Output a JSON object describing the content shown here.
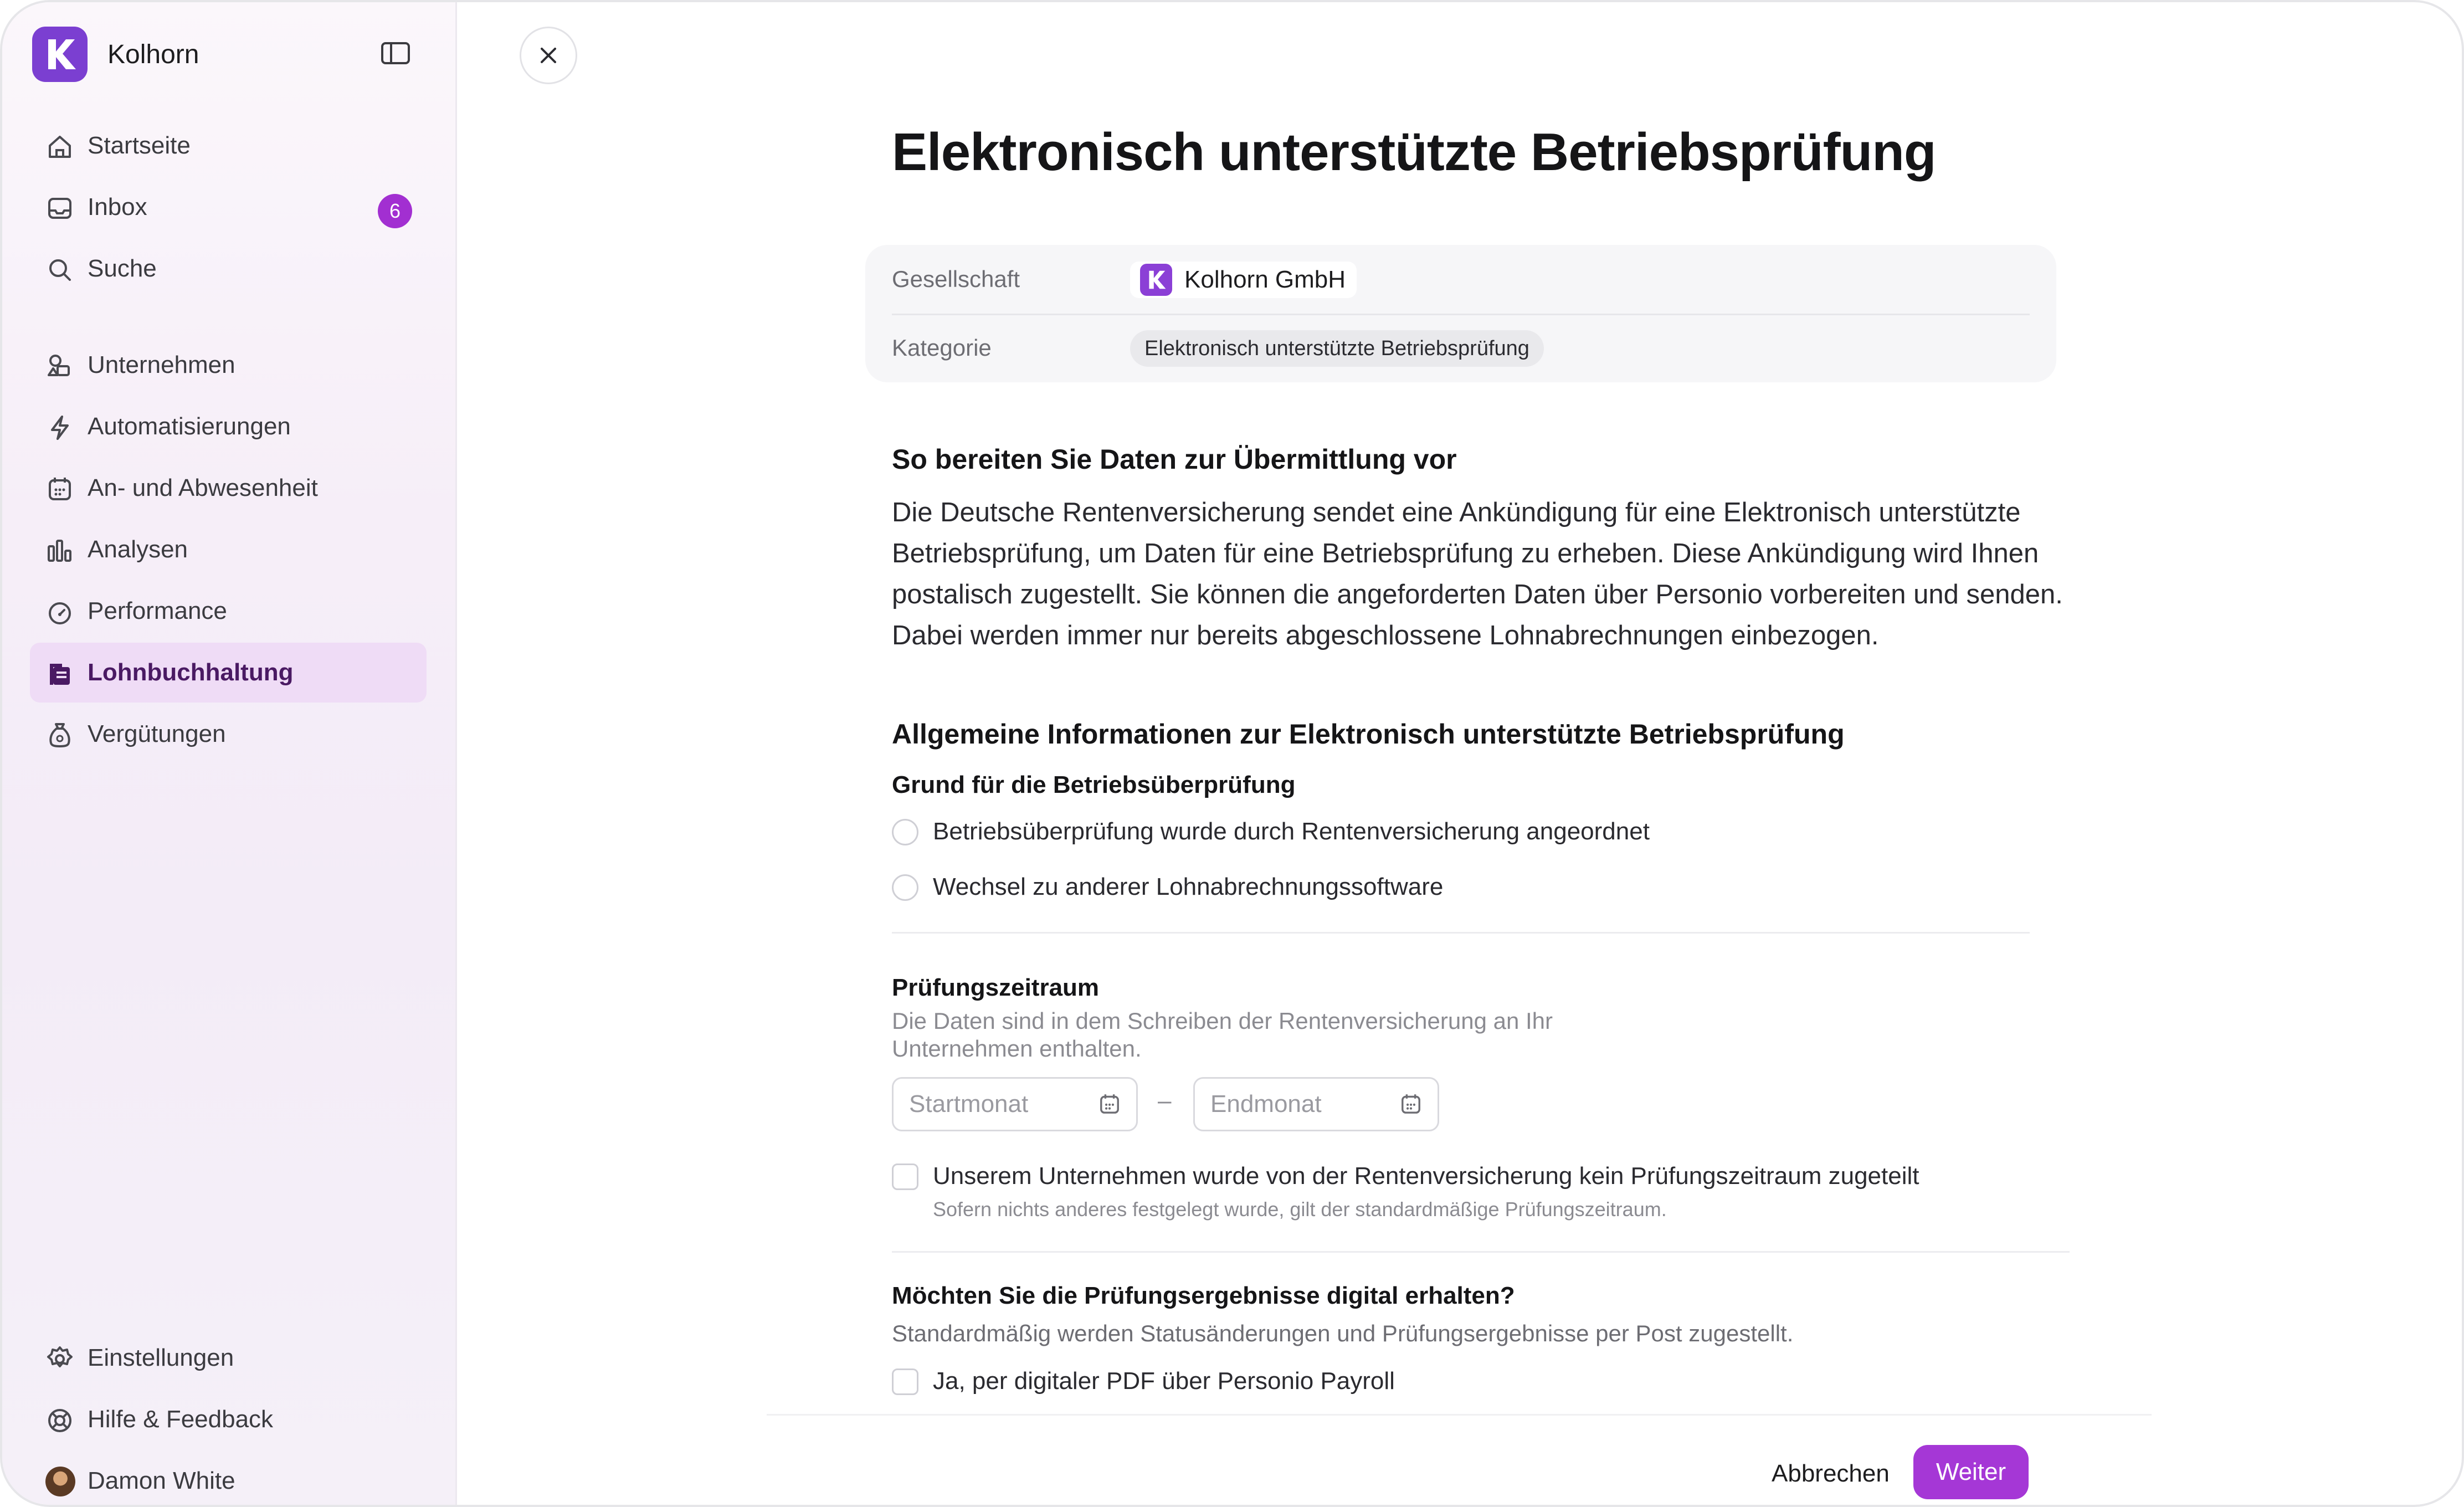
{
  "app": {
    "name": "Kolhorn"
  },
  "sidebar": {
    "collapse_icon": "sidebar-toggle-icon",
    "items": [
      {
        "label": "Startseite",
        "icon": "home-icon"
      },
      {
        "label": "Inbox",
        "icon": "inbox-icon",
        "badge": "6"
      },
      {
        "label": "Suche",
        "icon": "search-icon"
      },
      {
        "label": "Unternehmen",
        "icon": "shapes-icon"
      },
      {
        "label": "Automatisierungen",
        "icon": "lightning-icon"
      },
      {
        "label": "An- und Abwesenheit",
        "icon": "calendar-icon"
      },
      {
        "label": "Analysen",
        "icon": "bar-chart-icon"
      },
      {
        "label": "Performance",
        "icon": "gauge-icon"
      },
      {
        "label": "Lohnbuchhaltung",
        "icon": "payroll-icon",
        "active": true
      },
      {
        "label": "Vergütungen",
        "icon": "money-bag-icon"
      }
    ],
    "bottom": [
      {
        "label": "Einstellungen",
        "icon": "gear-icon"
      },
      {
        "label": "Hilfe & Feedback",
        "icon": "lifebuoy-icon"
      },
      {
        "label": "Damon White",
        "icon": "avatar"
      }
    ]
  },
  "page": {
    "title": "Elektronisch unterstützte Betriebsprüfung",
    "meta": {
      "company_key": "Gesellschaft",
      "company_value": "Kolhorn GmbH",
      "category_key": "Kategorie",
      "category_value": "Elektronisch unterstützte Betriebsprüfung"
    },
    "prep_heading": "So bereiten Sie Daten zur Übermittlung vor",
    "prep_text": "Die Deutsche Rentenversicherung sendet eine Ankündigung für eine Elektronisch unterstützte Betriebsprüfung, um Daten für eine Betriebsprüfung zu erheben. Diese Ankündigung wird Ihnen postalisch zugestellt. Sie können die angeforderten Daten über Personio vorbereiten und senden. Dabei werden immer nur bereits abgeschlossene Lohnabrechnungen einbezogen.",
    "info_heading": "Allgemeine Informationen zur Elektronisch unterstützte Betriebsprüfung",
    "reason_label": "Grund für die Betriebsüberprüfung",
    "reason_options": [
      "Betriebsüberprüfung wurde durch Rentenversicherung angeordnet",
      "Wechsel zu anderer Lohnabrechnungssoftware"
    ],
    "period_label": "Prüfungszeitraum",
    "period_hint": "Die Daten sind in dem Schreiben der Rentenversicherung an Ihr Unternehmen enthalten.",
    "start_placeholder": "Startmonat",
    "end_placeholder": "Endmonat",
    "range_dash": "–",
    "no_period_label": "Unserem Unternehmen wurde von der Rentenversicherung kein Prüfungszeitraum zugeteilt",
    "no_period_hint": "Sofern nichts anderes festgelegt wurde, gilt der standardmäßige Prüfungszeitraum.",
    "digital_label": "Möchten Sie die Prüfungsergebnisse digital erhalten?",
    "digital_hint": "Standardmäßig werden Statusänderungen und Prüfungsergebnisse per Post zugestellt.",
    "digital_option": "Ja, per digitaler PDF über Personio Payroll"
  },
  "footer": {
    "cancel": "Abbrechen",
    "next": "Weiter"
  },
  "colors": {
    "accent": "#a537d6",
    "brand": "#7b3fd1",
    "active_bg": "#efdcf6"
  }
}
